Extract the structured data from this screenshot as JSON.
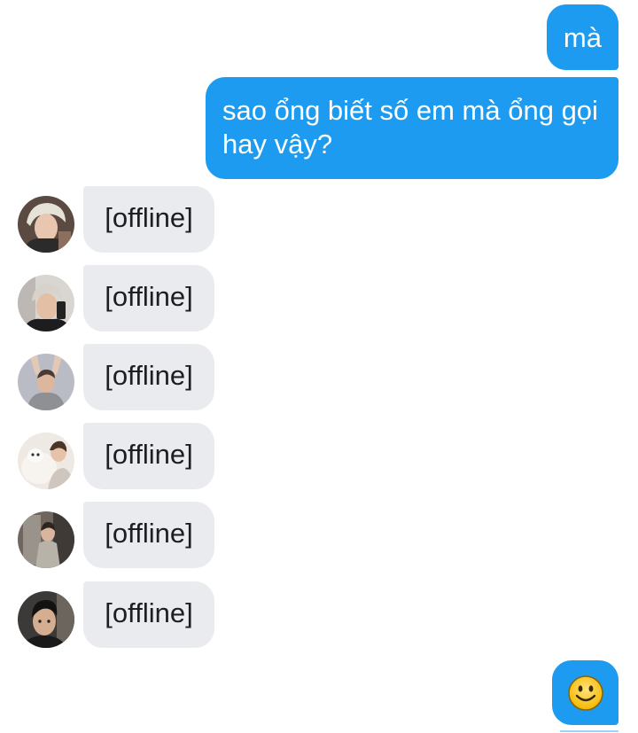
{
  "conversation": {
    "outgoing": [
      {
        "text": "mà"
      },
      {
        "text": "sao ổng biết số em mà ổng gọi hay vậy?"
      }
    ],
    "incoming": [
      {
        "text": "[offline]",
        "avatar_icon": "avatar-photo-icon"
      },
      {
        "text": "[offline]",
        "avatar_icon": "avatar-photo-icon"
      },
      {
        "text": "[offline]",
        "avatar_icon": "avatar-photo-icon"
      },
      {
        "text": "[offline]",
        "avatar_icon": "avatar-photo-icon"
      },
      {
        "text": "[offline]",
        "avatar_icon": "avatar-photo-icon"
      },
      {
        "text": "[offline]",
        "avatar_icon": "avatar-photo-icon"
      }
    ],
    "reaction_icon": "smiley-emoji-icon"
  },
  "colors": {
    "outgoing_bubble": "#1c9bf0",
    "incoming_bubble": "#e9ebee",
    "incoming_text": "#1c1e21",
    "outgoing_text": "#ffffff"
  }
}
